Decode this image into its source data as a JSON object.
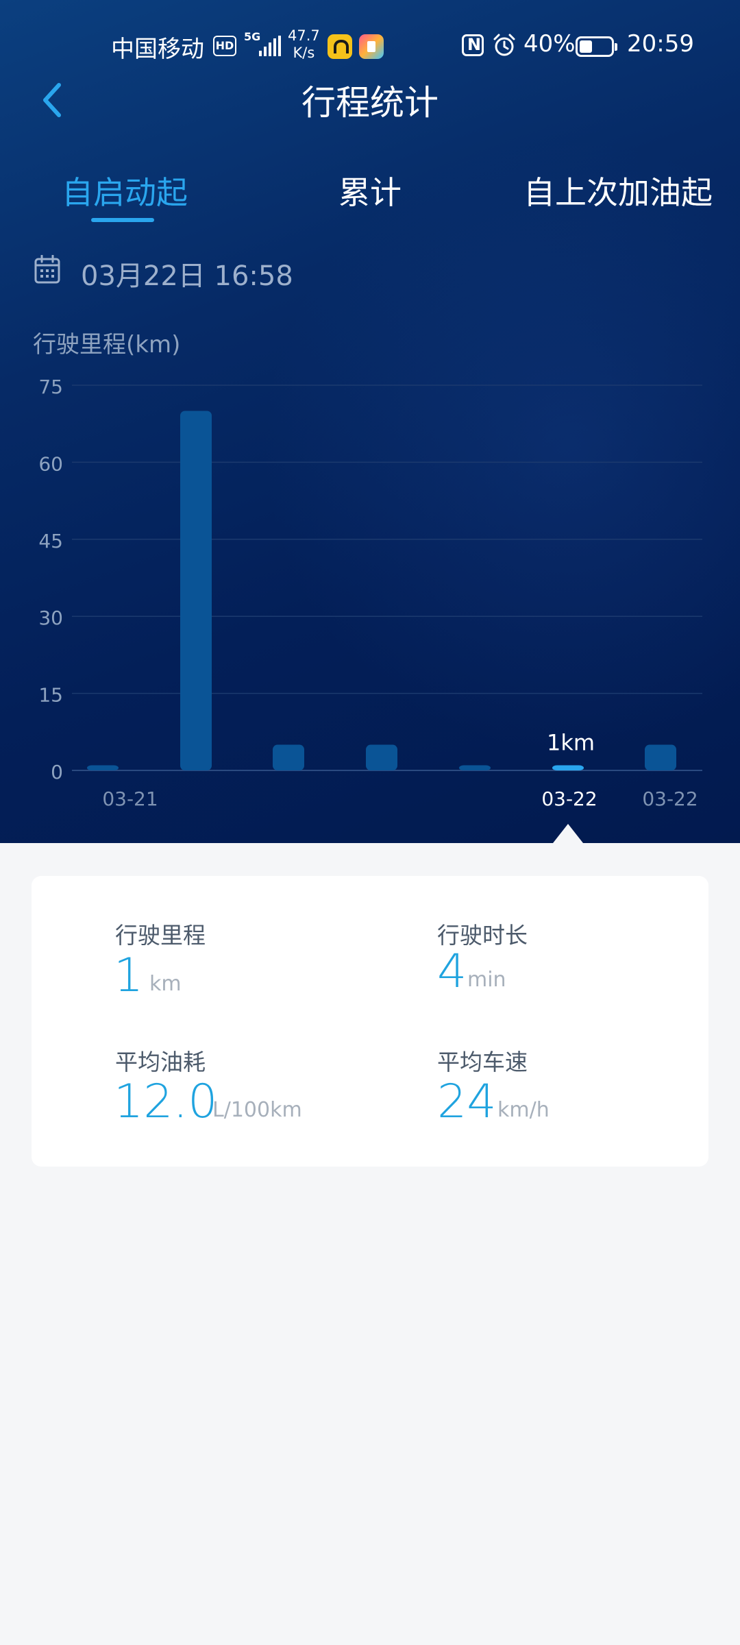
{
  "status_bar": {
    "carrier": "中国移动",
    "hd": "HD",
    "network": "5G",
    "speed_value": "47.7",
    "speed_unit": "K/s",
    "battery": "40%",
    "time": "20:59"
  },
  "header": {
    "title": "行程统计"
  },
  "tabs": [
    {
      "label": "自启动起",
      "active": true
    },
    {
      "label": "累计",
      "active": false
    },
    {
      "label": "自上次加油起",
      "active": false
    }
  ],
  "date": "03月22日 16:58",
  "chart_data": {
    "type": "bar",
    "ylabel": "行驶里程(km)",
    "ylim": [
      0,
      75
    ],
    "yticks": [
      0,
      15,
      30,
      45,
      60,
      75
    ],
    "values": [
      1,
      70,
      5,
      5,
      1,
      1,
      5
    ],
    "x_labels": [
      "03-21",
      "",
      "",
      "",
      "",
      "03-22",
      "03-22"
    ],
    "selected_index": 5,
    "selected_label": "1km",
    "colors": {
      "bar": "#0a5496",
      "selected": "#2aa6ee",
      "grid": "#1c3a6e"
    }
  },
  "stats": {
    "distance": {
      "label": "行驶里程",
      "value": "1",
      "unit": "km"
    },
    "duration": {
      "label": "行驶时长",
      "value": "4",
      "unit": "min"
    },
    "fuel": {
      "label": "平均油耗",
      "value": "12.0",
      "unit": "L/100km"
    },
    "speed": {
      "label": "平均车速",
      "value": "24",
      "unit": "km/h"
    }
  }
}
